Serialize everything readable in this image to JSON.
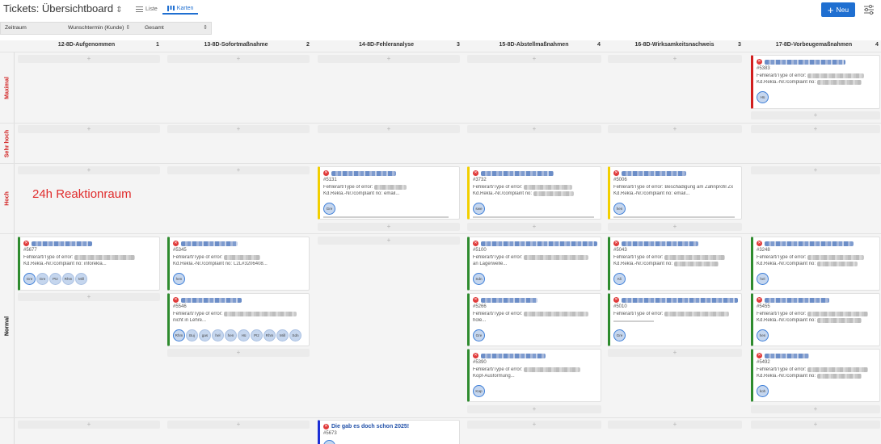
{
  "header": {
    "title": "Tickets: Übersichtboard",
    "views": [
      {
        "label": "Liste",
        "active": false
      },
      {
        "label": "Karten",
        "active": true
      }
    ],
    "new_label": "Neu",
    "accent_color": "#1f6fd1"
  },
  "filters": {
    "range": "Zeitraum",
    "sort": "Wunschtermin (Kunde)",
    "scope": "Gesamt"
  },
  "columns": [
    {
      "title": "12-8D-Aufgenommen",
      "count": "1"
    },
    {
      "title": "13-8D-Sofortmaßnahme",
      "count": "2"
    },
    {
      "title": "14-8D-Fehleranalyse",
      "count": "3"
    },
    {
      "title": "15-8D-Abstellmaßnahmen",
      "count": "4"
    },
    {
      "title": "16-8D-Wirksamkeitsnachweis",
      "count": "3"
    },
    {
      "title": "17-8D-Vorbeugemaßnahmen",
      "count": "4"
    }
  ],
  "priorities": [
    {
      "label": "Maximal",
      "color": "#d11e1e"
    },
    {
      "label": "Sehr hoch",
      "color": "#d11e1e"
    },
    {
      "label": "Hoch",
      "color": "#d11e1e"
    },
    {
      "label": "Normal",
      "color": "#111111"
    }
  ],
  "add_symbol": "+",
  "labels": {
    "error": "Fehlerart/Type of error:",
    "complaint": "Kd.Rekla.-Nr./complaint no:"
  },
  "annotation": "24h Reaktionraum",
  "cards": [
    {
      "id": "#5383",
      "error": "",
      "complaint": "",
      "avatars": [
        "Hü"
      ]
    },
    {
      "id": "#5131",
      "error": "",
      "complaint": "email...",
      "avatars": [
        "Gre"
      ]
    },
    {
      "id": "#3732",
      "error": "",
      "complaint": "",
      "avatars": [
        "swe"
      ]
    },
    {
      "id": "#5006",
      "error": "Beschädigung am Zahnprofil Zx",
      "complaint": "email...",
      "avatars": [
        "hen"
      ]
    },
    {
      "id": "#5677",
      "error": "",
      "complaint": "inforekla...",
      "avatars": [
        "Gre",
        "Gre",
        "Ptz",
        "Rhm",
        "Mill"
      ]
    },
    {
      "id": "#5345",
      "error": "",
      "complaint": "L2L#3206408...",
      "avatars": [
        "hen"
      ]
    },
    {
      "id": "#5100",
      "error": "",
      "extra": "an Lagerwelle...",
      "avatars": [
        "Sdn"
      ]
    },
    {
      "id": "#5043",
      "error": "",
      "complaint": "",
      "avatars": [
        "Kli"
      ]
    },
    {
      "id": "#3248",
      "error": "",
      "complaint": "",
      "avatars": [
        "hel"
      ]
    },
    {
      "id": "#5546",
      "error": "",
      "extra": "nicht in Lehre...",
      "avatars": [
        "Rhm",
        "Buj",
        "gas",
        "hel",
        "hen",
        "Hü",
        "Ptz",
        "Rhm",
        "Mill",
        "Sdn"
      ]
    },
    {
      "id": "#5266",
      "error": "",
      "extra": "hole...",
      "avatars": [
        "Gre"
      ]
    },
    {
      "id": "#5010",
      "error": "",
      "extra": "",
      "avatars": [
        "Gre"
      ]
    },
    {
      "id": "#5455",
      "error": "",
      "complaint": "",
      "avatars": [
        "hen"
      ]
    },
    {
      "id": "#5390",
      "error": "",
      "extra": "Kopf-Ausformung...",
      "avatars": [
        "Kap"
      ]
    },
    {
      "id": "#5492",
      "error": "",
      "complaint": "",
      "avatars": [
        "koh"
      ]
    },
    {
      "id": "#5673",
      "title": "Die gab es doch schon 2025!"
    }
  ]
}
